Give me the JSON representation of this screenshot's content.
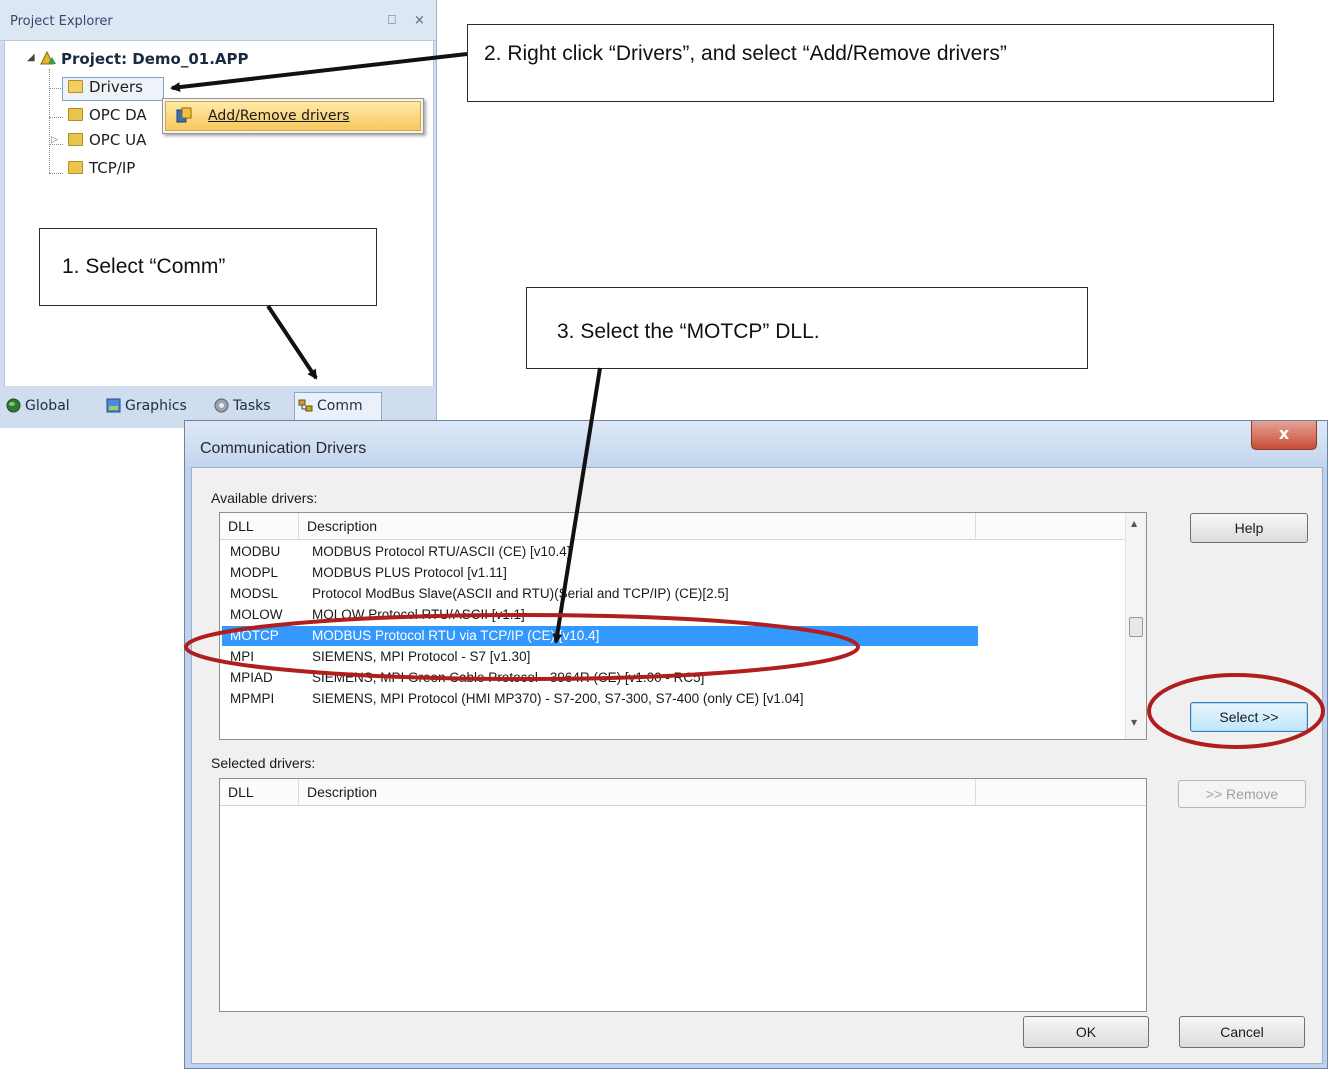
{
  "project_explorer": {
    "title": "Project Explorer",
    "pin_glyph": "⎕",
    "close_glyph": "×",
    "project_label": "Project: Demo_01.APP",
    "tree_items": [
      {
        "label": "Drivers"
      },
      {
        "label": "OPC DA"
      },
      {
        "label": "OPC UA"
      },
      {
        "label": "TCP/IP"
      }
    ],
    "context_menu": {
      "item": "Add/Remove drivers"
    },
    "tabs": [
      {
        "label": "Global",
        "icon": "globe-icon"
      },
      {
        "label": "Graphics",
        "icon": "graphics-icon"
      },
      {
        "label": "Tasks",
        "icon": "tasks-icon"
      },
      {
        "label": "Comm",
        "icon": "comm-icon"
      }
    ]
  },
  "callouts": {
    "step1": "1.   Select “Comm”",
    "step2": "2. Right click “Drivers”, and select “Add/Remove drivers”",
    "step3": "3. Select the “MOTCP” DLL."
  },
  "dialog": {
    "title": "Communication Drivers",
    "close_label": "x",
    "available_label": "Available drivers:",
    "selected_label": "Selected drivers:",
    "columns": [
      "DLL",
      "Description"
    ],
    "available_rows": [
      {
        "dll": "MODBU",
        "desc": "MODBUS Protocol RTU/ASCII (CE) [v10.4]"
      },
      {
        "dll": "MODPL",
        "desc": "MODBUS PLUS Protocol  [v1.11]"
      },
      {
        "dll": "MODSL",
        "desc": "Protocol ModBus Slave(ASCII and RTU)(Serial and TCP/IP) (CE)[2.5]"
      },
      {
        "dll": "MOLOW",
        "desc": "MOLOW Protocol RTU/ASCII [v1.1]"
      },
      {
        "dll": "MOTCP",
        "desc": "MODBUS Protocol RTU via TCP/IP (CE) [v10.4]",
        "selected": true
      },
      {
        "dll": "MPI",
        "desc": "SIEMENS, MPI Protocol - S7 [v1.30]"
      },
      {
        "dll": "MPIAD",
        "desc": "SIEMENS, MPI Green Cable Protocol - 3964R (CE) [v1.00 - RC5]"
      },
      {
        "dll": "MPMPI",
        "desc": "SIEMENS, MPI Protocol (HMI MP370) - S7-200, S7-300, S7-400 (only CE) [v1.04]"
      }
    ],
    "buttons": {
      "help": "Help",
      "select": "Select >>",
      "remove": ">> Remove",
      "ok": "OK",
      "cancel": "Cancel"
    }
  },
  "colors": {
    "selection": "#3399ff",
    "highlight_ellipse": "#b01e1e",
    "arrow": "#111111"
  }
}
